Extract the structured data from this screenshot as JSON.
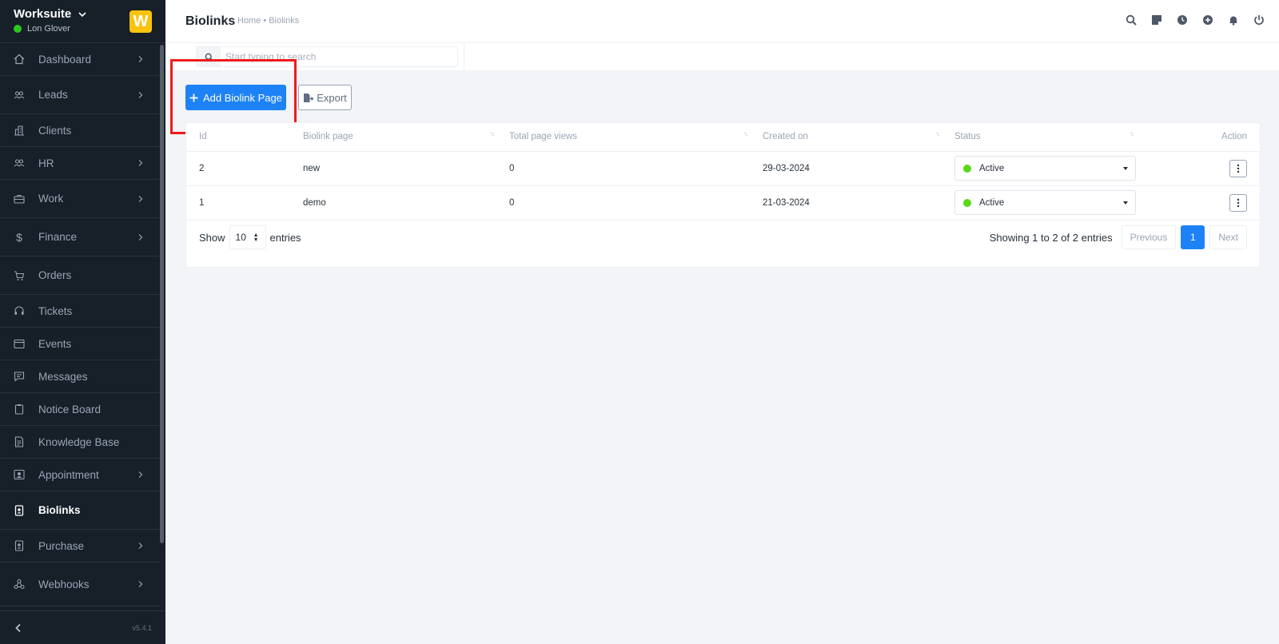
{
  "sidebar": {
    "brand": "Worksuite",
    "user": "Lon Glover",
    "logo_letter": "W",
    "version": "v5.4.1",
    "items": [
      {
        "label": "Dashboard",
        "icon": "home-icon",
        "has_arrow": true
      },
      {
        "label": "Leads",
        "icon": "users-icon",
        "has_arrow": true
      },
      {
        "label": "Clients",
        "icon": "building-icon",
        "has_arrow": false
      },
      {
        "label": "HR",
        "icon": "people-icon",
        "has_arrow": true
      },
      {
        "label": "Work",
        "icon": "briefcase-icon",
        "has_arrow": true
      },
      {
        "label": "Finance",
        "icon": "dollar-icon",
        "has_arrow": true
      },
      {
        "label": "Orders",
        "icon": "cart-icon",
        "has_arrow": false
      },
      {
        "label": "Tickets",
        "icon": "headset-icon",
        "has_arrow": false
      },
      {
        "label": "Events",
        "icon": "calendar-icon",
        "has_arrow": false
      },
      {
        "label": "Messages",
        "icon": "chat-icon",
        "has_arrow": false
      },
      {
        "label": "Notice Board",
        "icon": "clipboard-icon",
        "has_arrow": false
      },
      {
        "label": "Knowledge Base",
        "icon": "document-icon",
        "has_arrow": false
      },
      {
        "label": "Appointment",
        "icon": "contact-card-icon",
        "has_arrow": true
      },
      {
        "label": "Biolinks",
        "icon": "id-badge-icon",
        "has_arrow": false,
        "active": true
      },
      {
        "label": "Purchase",
        "icon": "receipt-icon",
        "has_arrow": true
      },
      {
        "label": "Webhooks",
        "icon": "webhook-icon",
        "has_arrow": true
      }
    ]
  },
  "header": {
    "title": "Biolinks",
    "breadcrumb": "Home • Biolinks"
  },
  "search": {
    "placeholder": "Start typing to search"
  },
  "actions": {
    "add_label": "Add Biolink Page",
    "export_label": "Export"
  },
  "table": {
    "columns": [
      "Id",
      "Biolink page",
      "Total page views",
      "Created on",
      "Status",
      "Action"
    ],
    "rows": [
      {
        "id": "2",
        "page": "new",
        "views": "0",
        "created": "29-03-2024",
        "status": "Active"
      },
      {
        "id": "1",
        "page": "demo",
        "views": "0",
        "created": "21-03-2024",
        "status": "Active"
      }
    ]
  },
  "pagination": {
    "show_label": "Show",
    "page_length": "10",
    "entries_label": "entries",
    "info": "Showing 1 to 2 of 2 entries",
    "previous": "Previous",
    "current": "1",
    "next": "Next"
  },
  "colors": {
    "primary": "#1d82f5",
    "sidebar_bg": "#171f29",
    "status_active": "#56d917",
    "highlight": "#ef1b1b"
  }
}
